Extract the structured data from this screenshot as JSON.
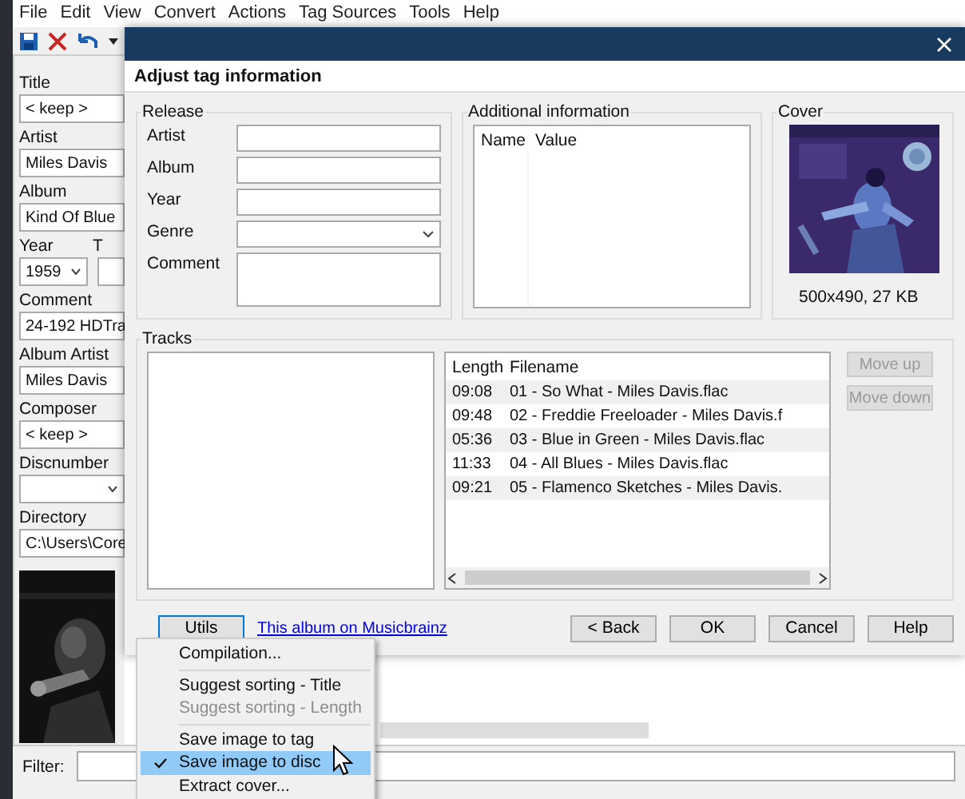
{
  "app": {
    "menu": [
      "File",
      "Edit",
      "View",
      "Convert",
      "Actions",
      "Tag Sources",
      "Tools",
      "Help"
    ],
    "fields": [
      {
        "label": "Title",
        "value": "< keep >",
        "kind": "text"
      },
      {
        "label": "Artist",
        "value": "Miles Davis",
        "kind": "text"
      },
      {
        "label": "Album",
        "value": "Kind Of Blue",
        "kind": "text"
      },
      {
        "label": "Year",
        "value": "1959",
        "kind": "year",
        "side_label": "T"
      },
      {
        "label": "Comment",
        "value": "24-192 HDTra",
        "kind": "text"
      },
      {
        "label": "Album Artist",
        "value": "Miles Davis",
        "kind": "text"
      },
      {
        "label": "Composer",
        "value": "< keep >",
        "kind": "text"
      },
      {
        "label": "Discnumber",
        "kind": "select"
      },
      {
        "label": "Directory",
        "value": "C:\\Users\\Core",
        "kind": "text"
      }
    ],
    "filter": {
      "label": "Filter:"
    }
  },
  "dialog": {
    "title": "Adjust tag information",
    "release": {
      "title": "Release",
      "fields": [
        {
          "label": "Artist",
          "kind": "text"
        },
        {
          "label": "Album",
          "kind": "text"
        },
        {
          "label": "Year",
          "kind": "text"
        },
        {
          "label": "Genre",
          "kind": "select"
        },
        {
          "label": "Comment",
          "kind": "multiline"
        }
      ]
    },
    "additional": {
      "title": "Additional information",
      "columns": [
        "Name",
        "Value"
      ]
    },
    "cover": {
      "title": "Cover",
      "info": "500x490, 27 KB"
    },
    "tracks": {
      "title": "Tracks",
      "columns": [
        "Length",
        "Filename"
      ],
      "rows": [
        {
          "length": "09:08",
          "filename": "01 - So What - Miles Davis.flac"
        },
        {
          "length": "09:48",
          "filename": "02 - Freddie Freeloader - Miles Davis.f"
        },
        {
          "length": "05:36",
          "filename": "03 - Blue in Green - Miles Davis.flac"
        },
        {
          "length": "11:33",
          "filename": "04 - All Blues - Miles Davis.flac"
        },
        {
          "length": "09:21",
          "filename": "05 - Flamenco Sketches - Miles Davis."
        }
      ],
      "side_buttons": [
        {
          "label": "Move up",
          "disabled": true
        },
        {
          "label": "Move down",
          "disabled": true
        }
      ]
    },
    "utils_button": "Utils",
    "link": "This album on Musicbrainz",
    "buttons": [
      "< Back",
      "OK",
      "Cancel",
      "Help"
    ]
  },
  "context_menu": {
    "groups": [
      [
        {
          "label": "Compilation...",
          "disabled": false,
          "checked": false,
          "selected": false
        }
      ],
      [
        {
          "label": "Suggest sorting - Title",
          "disabled": false,
          "checked": false,
          "selected": false
        },
        {
          "label": "Suggest sorting - Length",
          "disabled": true,
          "checked": false,
          "selected": false
        }
      ],
      [
        {
          "label": "Save image to tag",
          "disabled": false,
          "checked": false,
          "selected": false
        },
        {
          "label": "Save image to disc",
          "disabled": false,
          "checked": true,
          "selected": true
        },
        {
          "label": "Extract cover...",
          "disabled": false,
          "checked": false,
          "selected": false
        }
      ]
    ]
  }
}
